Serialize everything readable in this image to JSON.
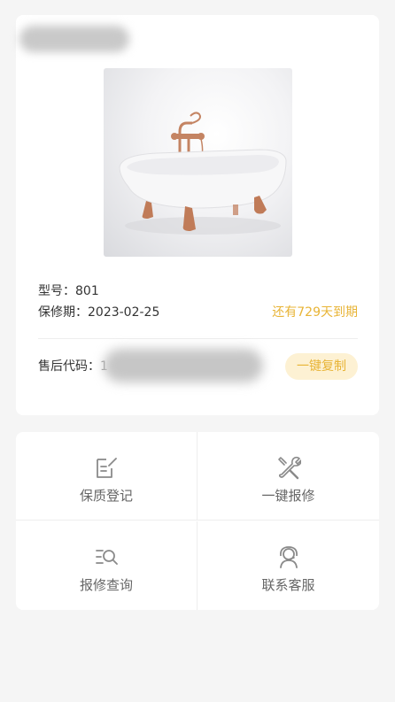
{
  "product": {
    "image": "bathtub-image",
    "model_label": "型号：",
    "model_value": "801",
    "warranty_label": "保修期：",
    "warranty_value": "2023-02-25",
    "expire_note": "还有729天到期",
    "aftersale_label": "售后代码：",
    "aftersale_value_partial": "1",
    "copy_button": "一键复制"
  },
  "menu": {
    "items": [
      {
        "label": "保质登记",
        "icon": "edit-document-icon"
      },
      {
        "label": "一键报修",
        "icon": "repair-tools-icon"
      },
      {
        "label": "报修查询",
        "icon": "search-list-icon"
      },
      {
        "label": "联系客服",
        "icon": "customer-service-icon"
      }
    ]
  },
  "colors": {
    "accent": "#e8b436",
    "accent_bg": "#fdf1d3",
    "page_bg": "#f5f5f5",
    "icon_gray": "#8a8a8a"
  }
}
